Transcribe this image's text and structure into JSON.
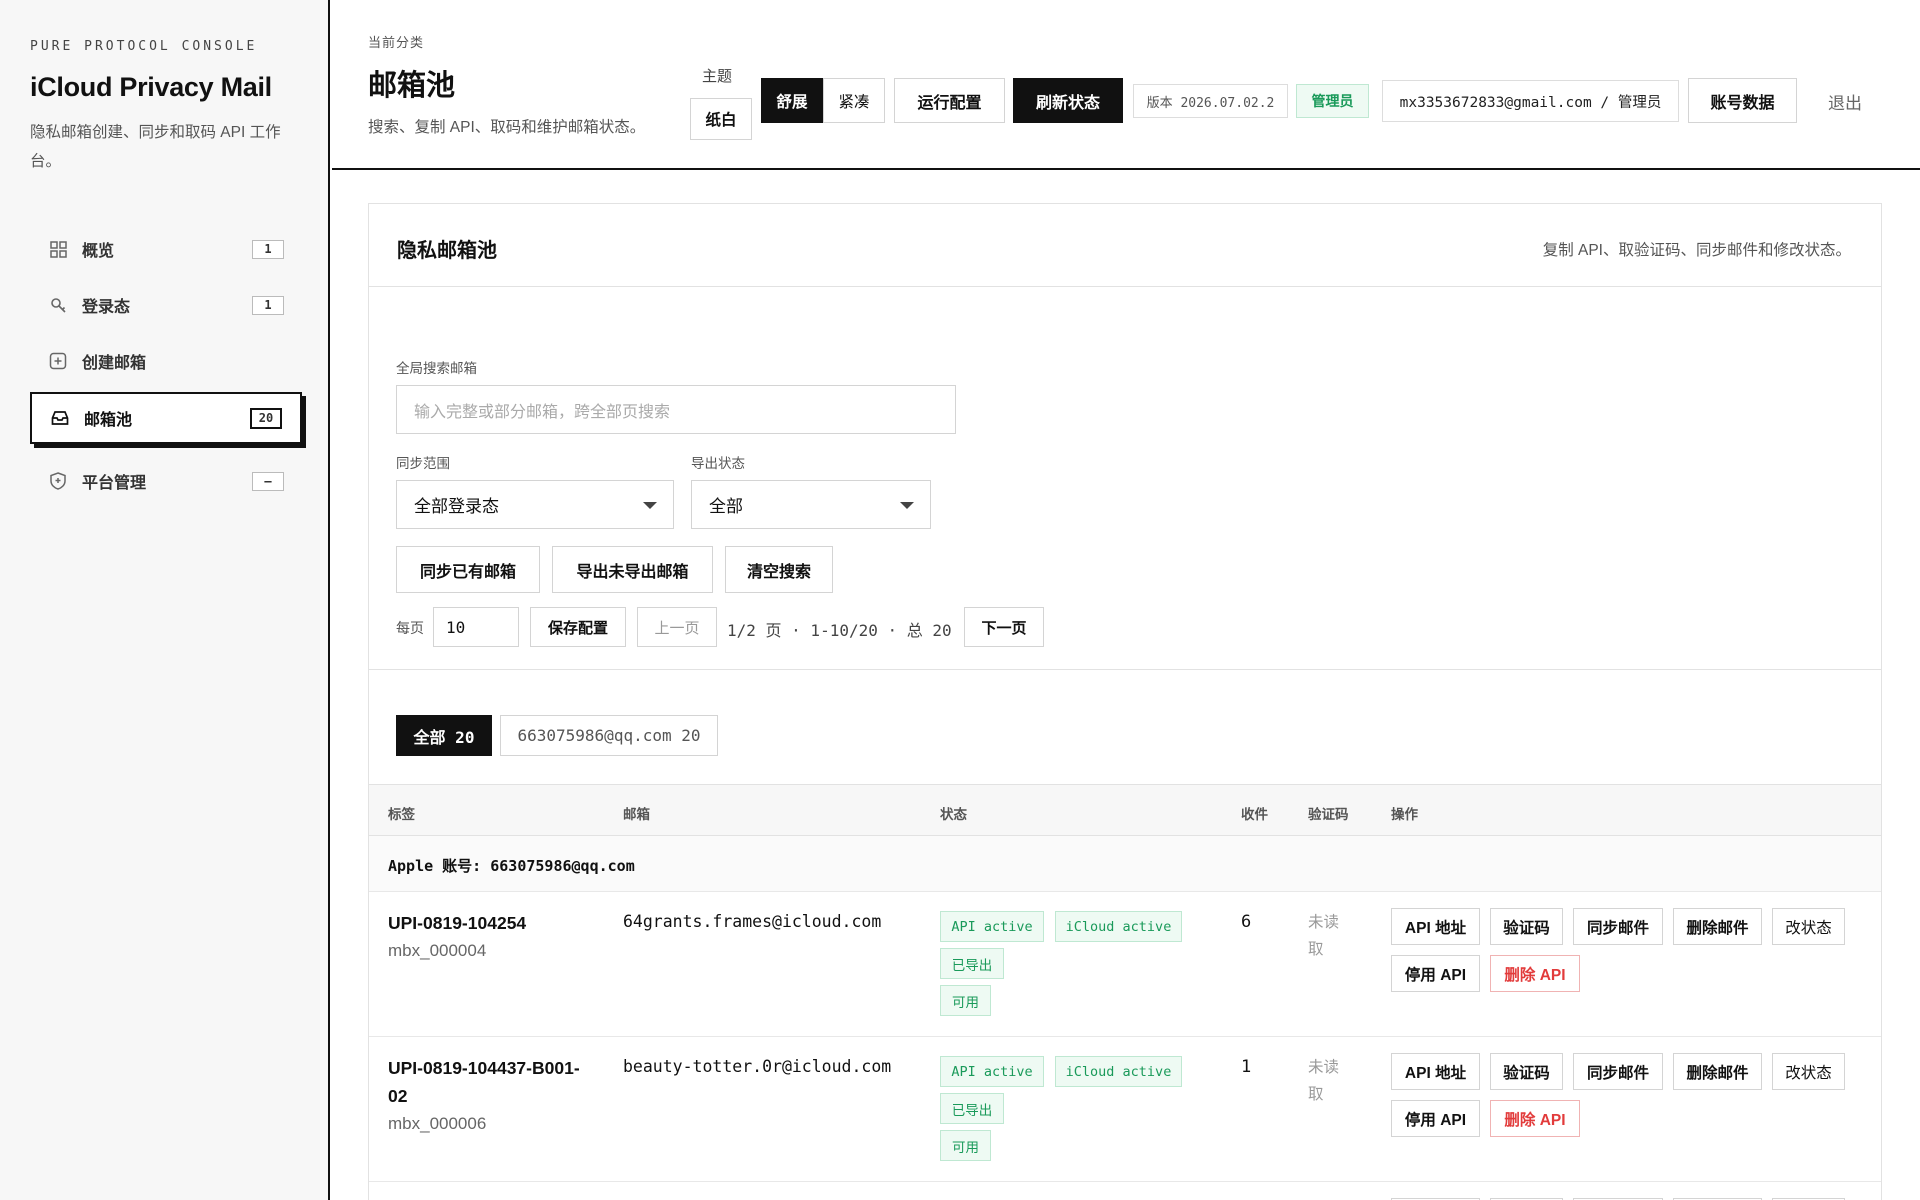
{
  "sidebar": {
    "kicker": "PURE PROTOCOL CONSOLE",
    "title": "iCloud Privacy Mail",
    "desc": "隐私邮箱创建、同步和取码 API 工作台。",
    "items": [
      {
        "label": "概览",
        "badge": "1",
        "icon": "grid-icon"
      },
      {
        "label": "登录态",
        "badge": "1",
        "icon": "key-icon"
      },
      {
        "label": "创建邮箱",
        "badge": "",
        "icon": "plus-square-icon"
      },
      {
        "label": "邮箱池",
        "badge": "20",
        "icon": "inbox-icon"
      },
      {
        "label": "平台管理",
        "badge": "—",
        "icon": "shield-icon"
      }
    ]
  },
  "header": {
    "crumb": "当前分类",
    "title": "邮箱池",
    "subtitle": "搜索、复制 API、取码和维护邮箱状态。",
    "theme_label": "主题",
    "theme_paper": "纸白",
    "density_spacious": "舒展",
    "density_compact": "紧凑",
    "run_config": "运行配置",
    "refresh": "刷新状态",
    "version": "版本 2026.07.02.2",
    "role_badge": "管理员",
    "user": "mx3353672833@gmail.com / 管理员",
    "account_data": "账号数据",
    "logout": "退出"
  },
  "panel": {
    "title": "隐私邮箱池",
    "hint": "复制 API、取验证码、同步邮件和修改状态。",
    "search_label": "全局搜索邮箱",
    "search_placeholder": "输入完整或部分邮箱，跨全部页搜索",
    "sync_scope_label": "同步范围",
    "sync_scope_value": "全部登录态",
    "export_status_label": "导出状态",
    "export_status_value": "全部",
    "sync_btn": "同步已有邮箱",
    "export_btn": "导出未导出邮箱",
    "clear_btn": "清空搜索",
    "per_page_label": "每页",
    "per_page_value": "10",
    "save_config": "保存配置",
    "prev_page": "上一页",
    "page_info": "1/2 页 · 1-10/20 · 总 20",
    "next_page": "下一页",
    "filter_all": "全部 20",
    "filter_account": "663075986@qq.com 20"
  },
  "table": {
    "headers": [
      "标签",
      "邮箱",
      "状态",
      "收件",
      "验证码",
      "操作"
    ],
    "group": "Apple 账号: 663075986@qq.com",
    "actions": {
      "api_addr": "API 地址",
      "code": "验证码",
      "sync_mail": "同步邮件",
      "delete_mail": "删除邮件",
      "change_status": "改状态",
      "disable_api": "停用 API",
      "delete_api": "删除 API"
    },
    "rows": [
      {
        "label": "UPI-0819-104254",
        "id": "mbx_000004",
        "email": "64grants.frames@icloud.com",
        "status": [
          "API active",
          "iCloud active",
          "已导出",
          "可用"
        ],
        "count": "6",
        "code": "未读取"
      },
      {
        "label": "UPI-0819-104437-B001-02",
        "id": "mbx_000006",
        "email": "beauty-totter.0r@icloud.com",
        "status": [
          "API active",
          "iCloud active",
          "已导出",
          "可用"
        ],
        "count": "1",
        "code": "未读取"
      }
    ]
  },
  "colors": {
    "accent": "#111111",
    "success": "#1a9a5a",
    "danger": "#e23b3b"
  }
}
